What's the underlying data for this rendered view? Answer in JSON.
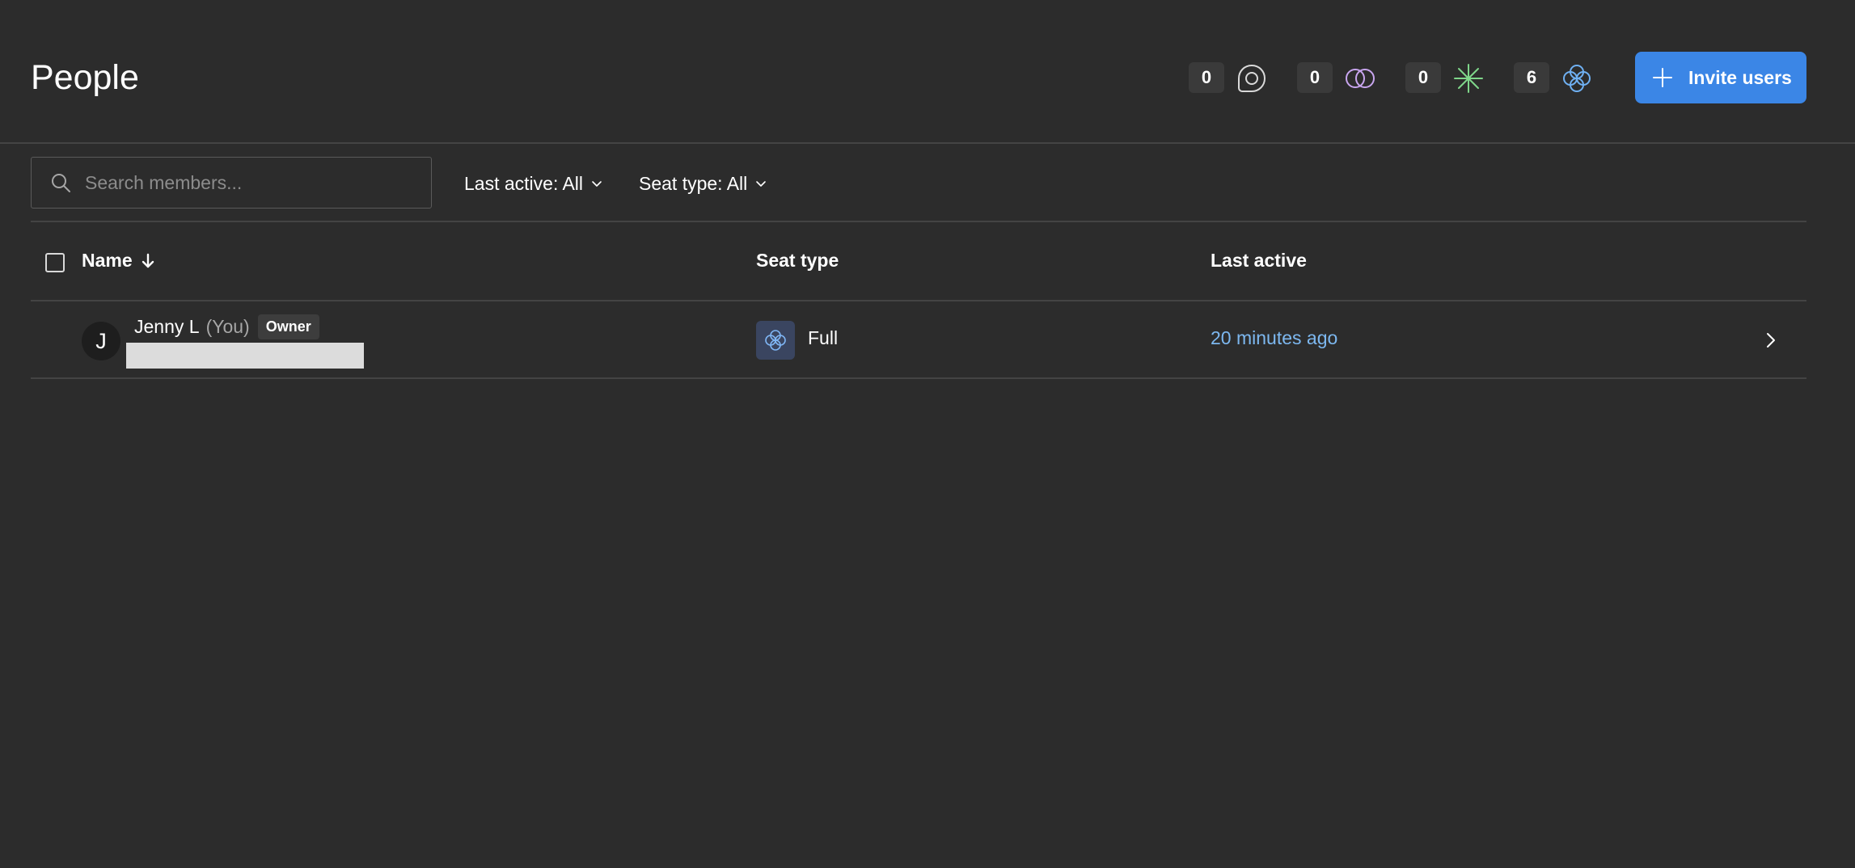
{
  "header": {
    "title": "People",
    "counters": [
      {
        "count": "0",
        "icon": "dev-mode-icon",
        "color": "#d9d9d9"
      },
      {
        "count": "0",
        "icon": "collab-seat-icon",
        "color": "#c9a6f0"
      },
      {
        "count": "0",
        "icon": "dev-seat-icon",
        "color": "#7fd68a"
      },
      {
        "count": "6",
        "icon": "full-seat-icon",
        "color": "#6fb0f2"
      }
    ],
    "invite_label": "Invite users",
    "accent": "#3b86e6"
  },
  "toolbar": {
    "search_placeholder": "Search members...",
    "search_value": "",
    "filter_last_active": "Last active: All",
    "filter_seat_type": "Seat type: All"
  },
  "table": {
    "columns": {
      "name": "Name",
      "seat_type": "Seat type",
      "last_active": "Last active"
    },
    "rows": [
      {
        "avatar_initial": "J",
        "name": "Jenny L",
        "you": "(You)",
        "role": "Owner",
        "seat_type": "Full",
        "last_active": "20 minutes ago"
      }
    ]
  }
}
